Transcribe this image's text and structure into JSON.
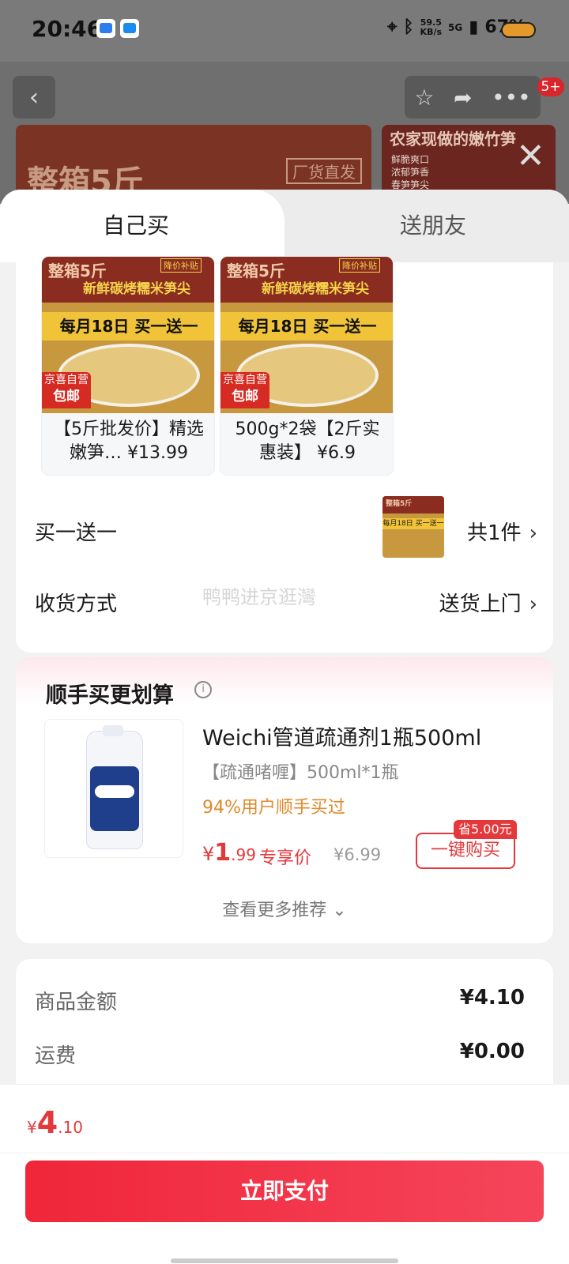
{
  "status_bar": {
    "time": "20:46",
    "speed_value": "59.5",
    "speed_unit": "KB/s",
    "network": "5G",
    "battery": "67%"
  },
  "background": {
    "hero_title": "整箱5斤",
    "hero_tag": "厂货直发",
    "hero2_title": "农家现做的嫩竹笋",
    "hero2_features": [
      "鲜脆爽口",
      "浓郁笋香",
      "春笋笋尖"
    ],
    "cart_badge": "5+"
  },
  "tabs": [
    {
      "label": "自己买",
      "active": true
    },
    {
      "label": "送朋友",
      "active": false
    }
  ],
  "products": [
    {
      "name": "【5斤批发价】精选嫩笋… ¥13.99",
      "image_title": "整箱5斤",
      "image_tag": "降价补贴",
      "image_subtitle": "新鲜碳烤糯米笋尖",
      "image_promo": "每月18日 买一送一",
      "image_badge_top": "京喜自营",
      "image_badge_bottom": "包邮"
    },
    {
      "name": "500g*2袋【2斤实惠装】 ¥6.9",
      "image_title": "整箱5斤",
      "image_tag": "降价补贴",
      "image_subtitle": "新鲜碳烤糯米笋尖",
      "image_promo": "每月18日 买一送一",
      "image_badge_top": "京喜自营",
      "image_badge_bottom": "包邮"
    }
  ],
  "promo_row": {
    "label": "买一送一",
    "count": "共1件",
    "mini_title": "整箱5斤",
    "mini_promo": "每月18日 买一送一"
  },
  "delivery_row": {
    "label": "收货方式",
    "value": "送货上门"
  },
  "watermark": "鸭鸭进京逛灣",
  "recommend": {
    "title": "顺手买更划算",
    "info_icon": "i",
    "item_name": "Weichi管道疏通剂1瓶500ml",
    "item_spec": "【疏通啫喱】500ml*1瓶",
    "item_hint": "94%用户顺手买过",
    "price_currency": "¥",
    "price_int": "1",
    "price_dec": ".99",
    "price_label": "专享价",
    "orig_price": "¥6.99",
    "save_tag": "省5.00元",
    "buy_label": "一键购买",
    "more_label": "查看更多推荐 ⌄"
  },
  "summary": [
    {
      "label": "商品金额",
      "value": "¥4.10"
    },
    {
      "label": "运费",
      "value": "¥0.00"
    }
  ],
  "footer": {
    "currency": "¥",
    "total_int": "4",
    "total_dec": ".10",
    "pay_label": "立即支付"
  },
  "icons": {
    "back": "back-icon",
    "favorite": "star-icon",
    "share": "share-icon",
    "more": "more-icon",
    "close": "close-icon",
    "chevron": "chevron-right-icon"
  },
  "colors": {
    "accent": "#e4393c",
    "pay_button": "#f0263a",
    "hint": "#e08a2a"
  }
}
